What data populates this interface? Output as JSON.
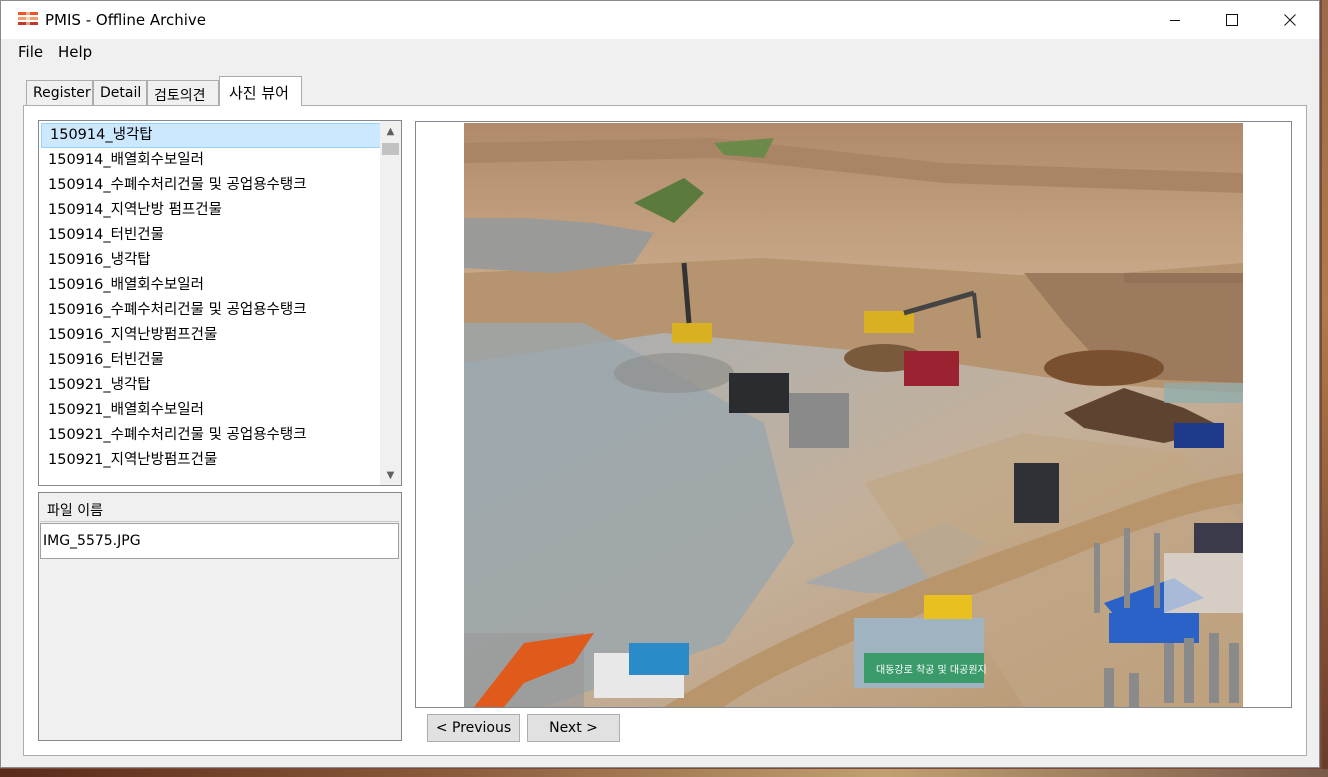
{
  "window": {
    "title": "PMIS - Offline Archive"
  },
  "menu": {
    "file": "File",
    "help": "Help"
  },
  "tabs": [
    {
      "label": "Register"
    },
    {
      "label": "Detail"
    },
    {
      "label": "검토의견"
    },
    {
      "label": "사진 뷰어"
    }
  ],
  "folders": [
    "150914_냉각탑",
    "150914_배열회수보일러",
    "150914_수폐수처리건물 및 공업용수탱크",
    "150914_지역난방 펌프건물",
    "150914_터빈건물",
    "150916_냉각탑",
    "150916_배열회수보일러",
    "150916_수폐수처리건물 및 공업용수탱크",
    "150916_지역난방펌프건물",
    "150916_터빈건물",
    "150921_냉각탑",
    "150921_배열회수보일러",
    "150921_수폐수처리건물 및 공업용수탱크",
    "150921_지역난방펌프건물"
  ],
  "file_grid": {
    "header": "파일 이름",
    "rows": [
      "IMG_5575.JPG"
    ]
  },
  "photo": {
    "banner": "대동강로 착공 및 대공원지"
  },
  "buttons": {
    "previous": "< Previous",
    "next": "Next >"
  }
}
